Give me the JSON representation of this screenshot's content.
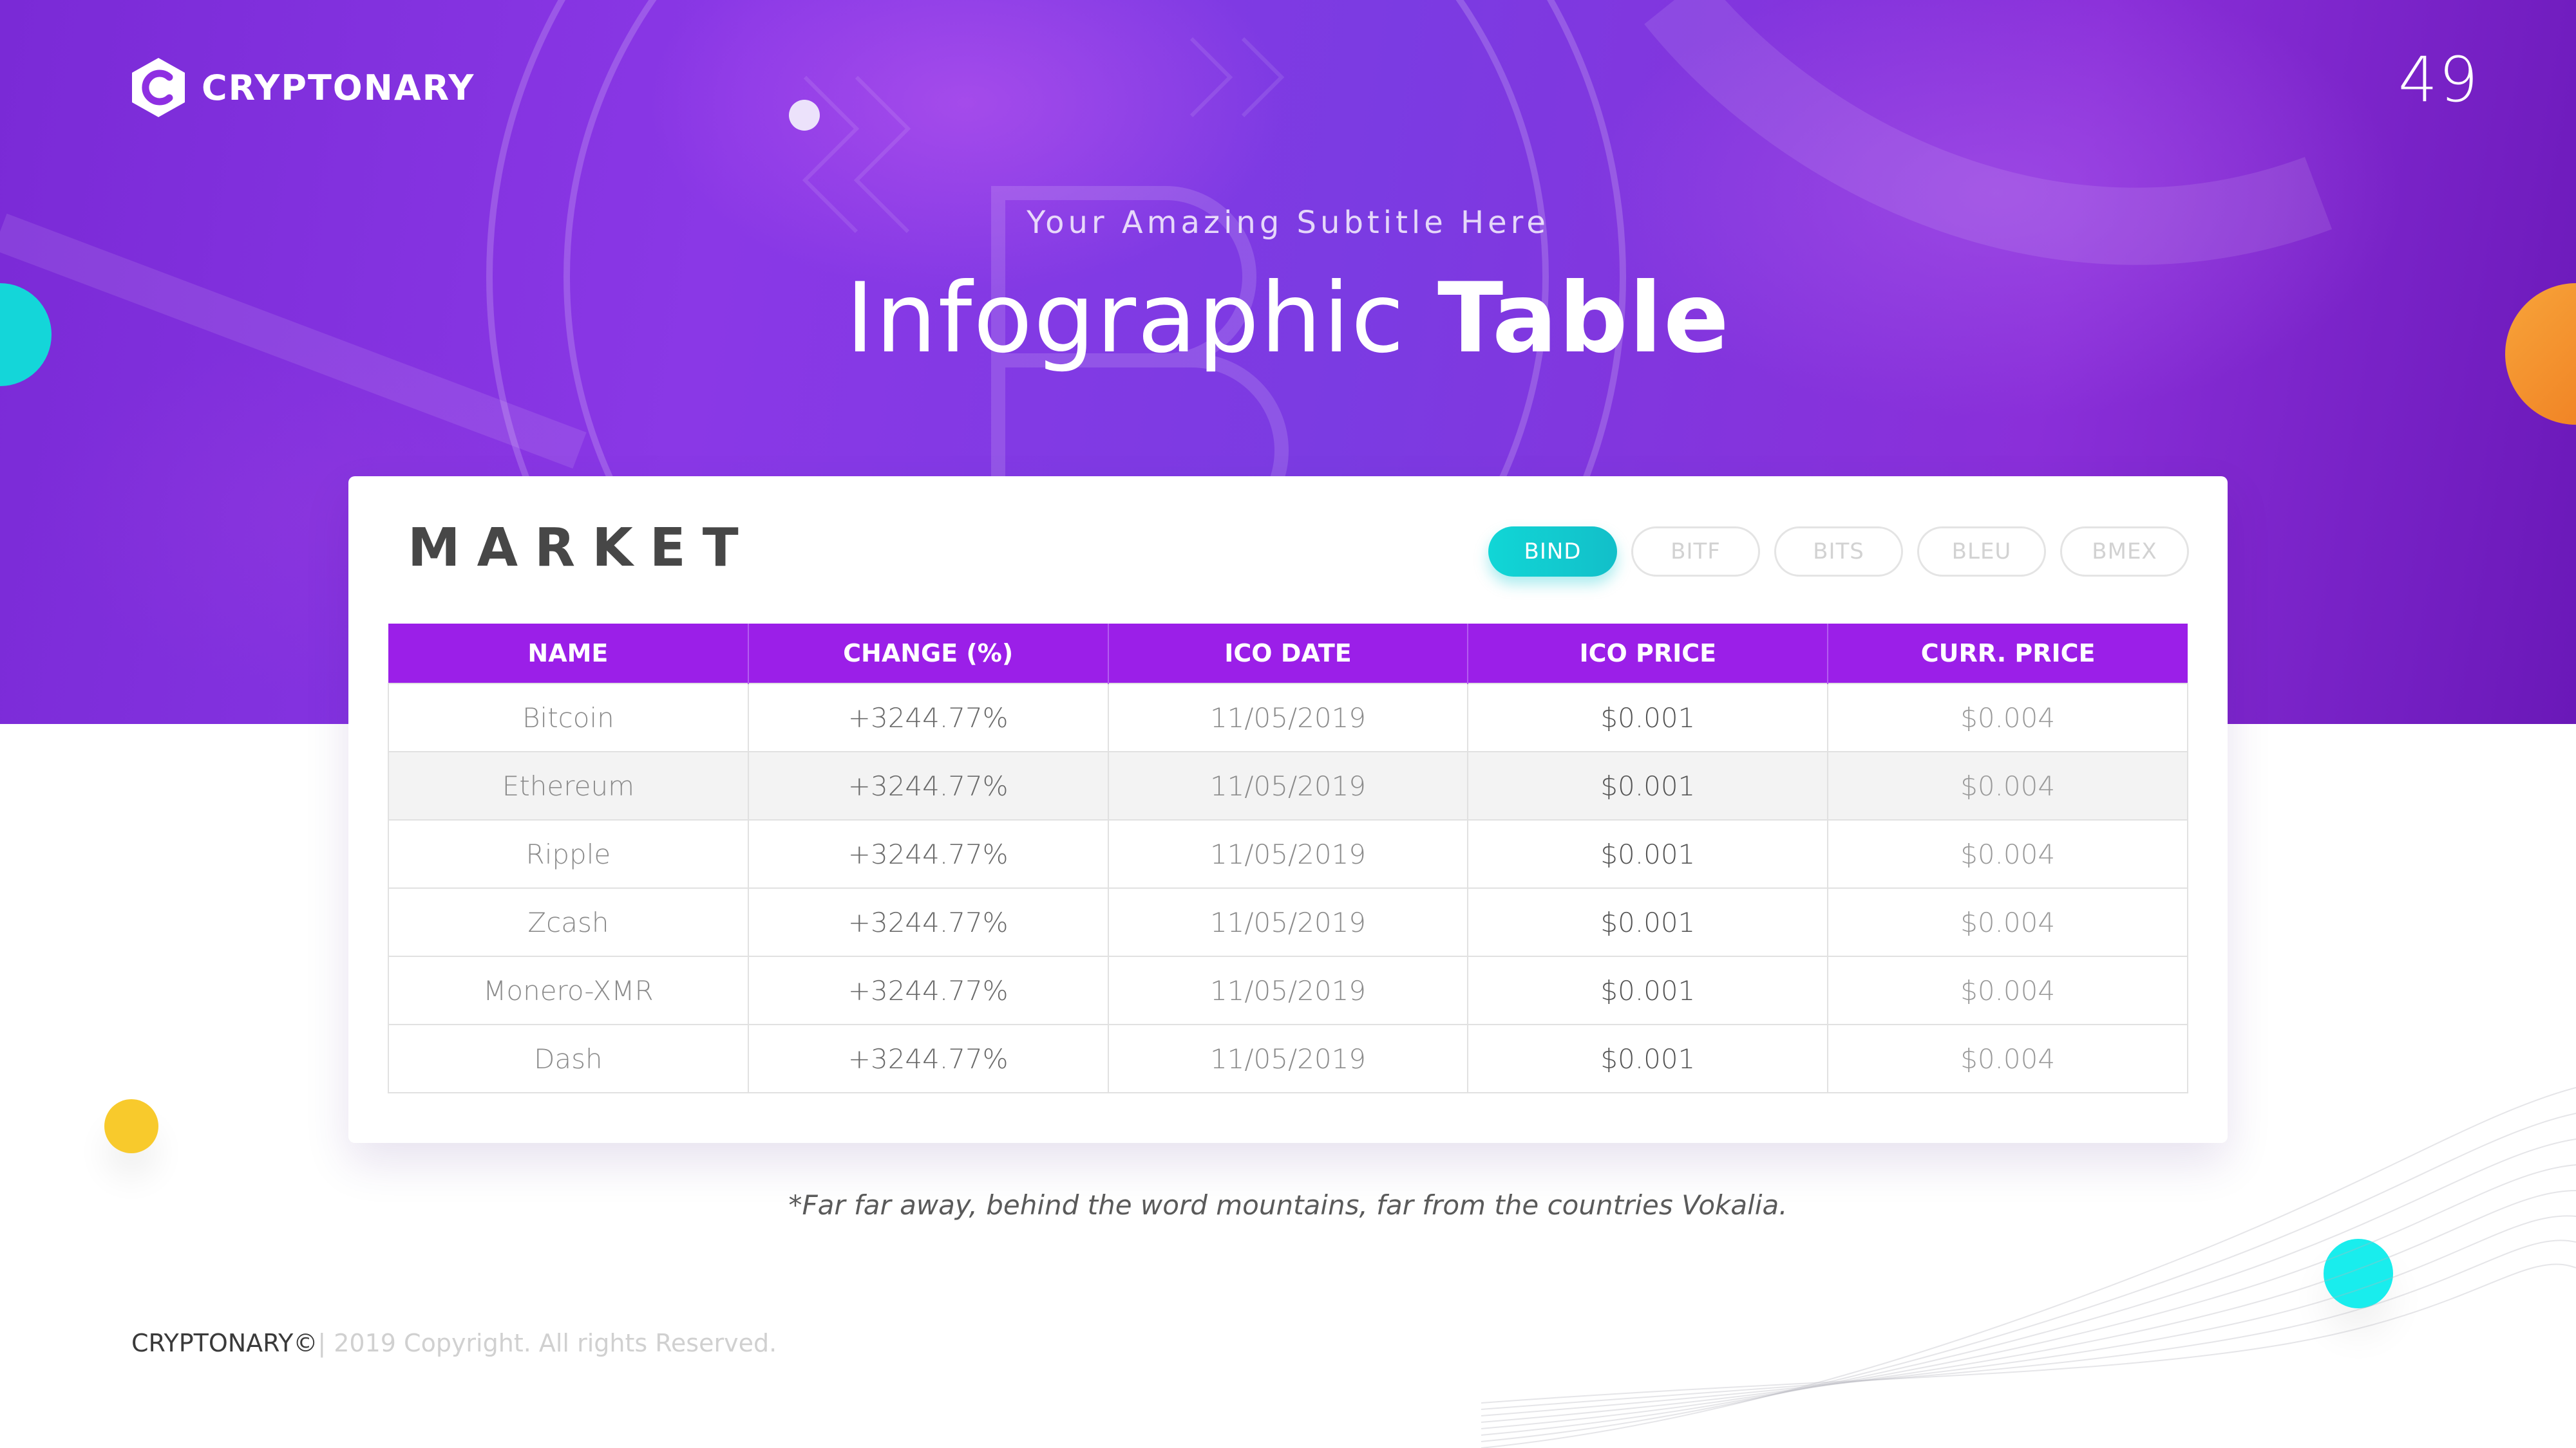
{
  "brand": {
    "name": "CRYPTONARY",
    "icon": "cryptonary-logo-icon"
  },
  "page_number": "49",
  "header": {
    "subtitle": "Your Amazing Subtitle Here",
    "title_light": "Infographic",
    "title_bold": "Table"
  },
  "card": {
    "title": "MARKET",
    "tabs": [
      {
        "label": "BIND",
        "active": true
      },
      {
        "label": "BITF",
        "active": false
      },
      {
        "label": "BITS",
        "active": false
      },
      {
        "label": "BLEU",
        "active": false
      },
      {
        "label": "BMEX",
        "active": false
      }
    ],
    "table": {
      "columns": [
        "NAME",
        "CHANGE (%)",
        "ICO DATE",
        "ICO PRICE",
        "CURR. PRICE"
      ],
      "rows": [
        [
          "Bitcoin",
          "+3244.77%",
          "11/05/2019",
          "$0.001",
          "$0.004"
        ],
        [
          "Ethereum",
          "+3244.77%",
          "11/05/2019",
          "$0.001",
          "$0.004"
        ],
        [
          "Ripple",
          "+3244.77%",
          "11/05/2019",
          "$0.001",
          "$0.004"
        ],
        [
          "Zcash",
          "+3244.77%",
          "11/05/2019",
          "$0.001",
          "$0.004"
        ],
        [
          "Monero-XMR",
          "+3244.77%",
          "11/05/2019",
          "$0.001",
          "$0.004"
        ],
        [
          "Dash",
          "+3244.77%",
          "11/05/2019",
          "$0.001",
          "$0.004"
        ]
      ]
    }
  },
  "footnote": "*Far far away, behind the word mountains, far from the countries Vokalia.",
  "footer": {
    "brand": "CRYPTONARY©",
    "copyright": "| 2019 Copyright. All rights Reserved."
  },
  "colors": {
    "header_purple": "#9b1fe8",
    "accent_cyan": "#11d6d6",
    "accent_orange": "#f0821f",
    "accent_yellow": "#f8ca2c"
  }
}
